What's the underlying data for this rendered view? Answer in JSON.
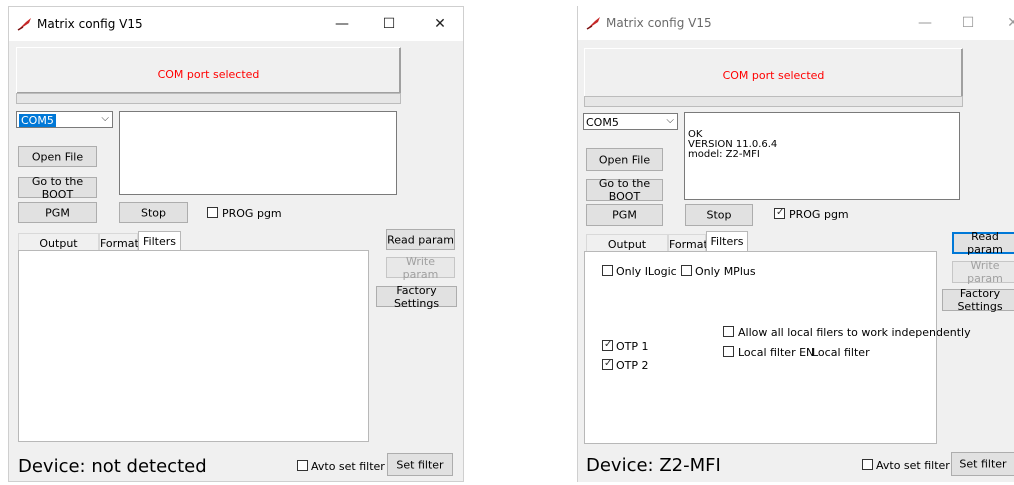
{
  "windows": [
    {
      "title": "Matrix config V15",
      "status_text": "COM port selected",
      "com_port": "COM5",
      "output_lines": [],
      "buttons": {
        "open_file": "Open File",
        "go_to_boot": "Go to the BOOT",
        "pgm": "PGM",
        "stop": "Stop",
        "read_param": "Read param",
        "write_param": "Write param",
        "factory_settings": "Factory Settings",
        "set_filter": "Set filter"
      },
      "prog_pgm": {
        "label": "PROG pgm",
        "checked": false
      },
      "tabs": [
        "Output protocol",
        "Format",
        "Filters"
      ],
      "active_tab": "Filters",
      "device_text": "Device: not detected",
      "avto_set_filter": {
        "label": "Avto set filter",
        "checked": false
      }
    },
    {
      "title": "Matrix config V15",
      "status_text": "COM port selected",
      "com_port": "COM5",
      "output_lines": [
        "OK",
        "VERSION  11.0.6.4",
        "model: Z2-MFI"
      ],
      "buttons": {
        "open_file": "Open File",
        "go_to_boot": "Go to the BOOT",
        "pgm": "PGM",
        "stop": "Stop",
        "read_param": "Read param",
        "write_param": "Write param",
        "factory_settings": "Factory Settings",
        "set_filter": "Set filter"
      },
      "prog_pgm": {
        "label": "PROG pgm",
        "checked": true
      },
      "tabs": [
        "Output protocol",
        "Format",
        "Filters"
      ],
      "active_tab": "Filters",
      "filters": {
        "only_ilogic": {
          "label": "Only ILogic",
          "checked": false
        },
        "only_mplus": {
          "label": "Only MPlus",
          "checked": false
        },
        "otp1": {
          "label": "OTP 1",
          "checked": true
        },
        "otp2": {
          "label": "OTP 2",
          "checked": true
        },
        "allow_local": {
          "label": "Allow all local filers to work independently",
          "checked": false
        },
        "local_filter_en": {
          "label": "Local filter EN",
          "checked": false
        },
        "local_filter_label": "Local filter"
      },
      "device_text": "Device: Z2-MFI",
      "avto_set_filter": {
        "label": "Avto set filter",
        "checked": false
      }
    }
  ],
  "icons": {
    "app": "feather-pen-icon",
    "minimize": "minimize-icon",
    "maximize": "maximize-icon",
    "close": "close-icon"
  },
  "colors": {
    "status_text": "#ff0000",
    "selection": "#0078d7",
    "window_bg": "#f0f0f0"
  }
}
